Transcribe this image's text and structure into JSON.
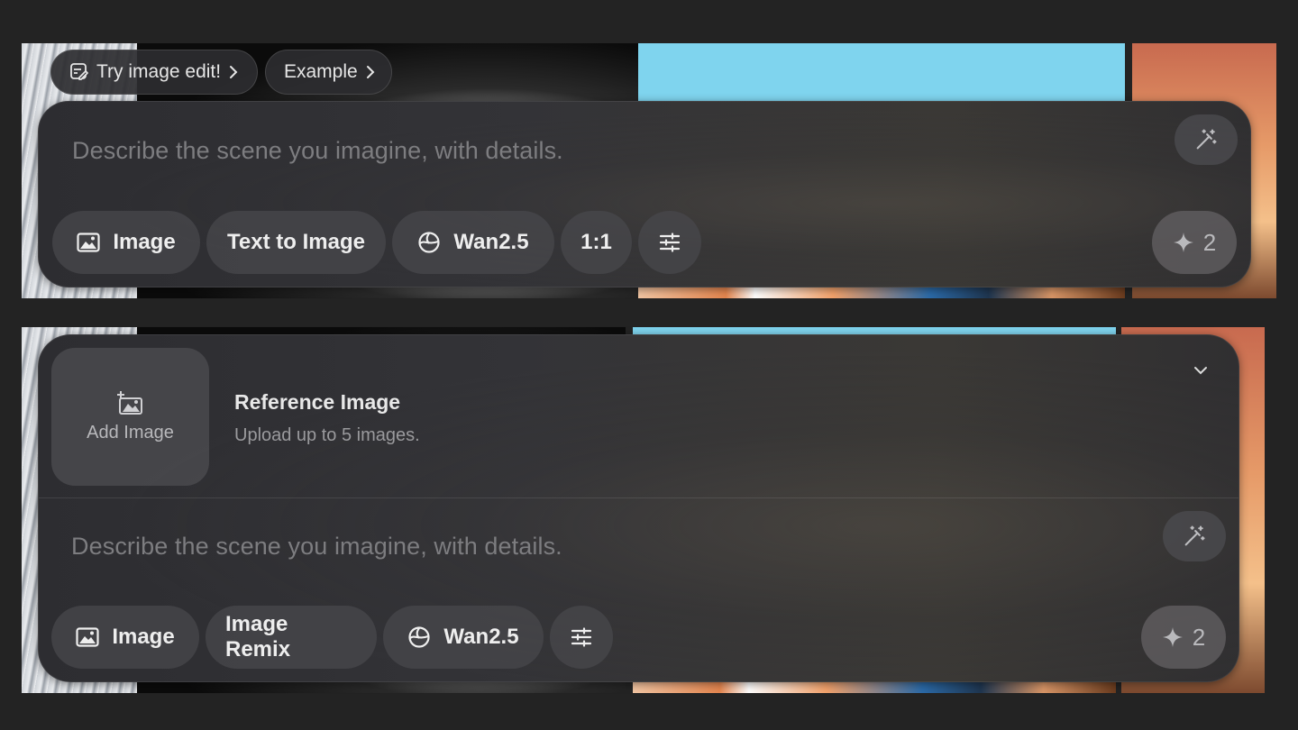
{
  "top_chips": {
    "try_edit": "Try image edit!",
    "example": "Example"
  },
  "panel1": {
    "placeholder": "Describe the scene you imagine, with details.",
    "mode": "Image",
    "task": "Text to Image",
    "model": "Wan2.5",
    "ratio": "1:1",
    "credits": "2"
  },
  "panel2": {
    "add_image": "Add Image",
    "ref_title": "Reference Image",
    "ref_subtitle": "Upload up to 5 images.",
    "placeholder": "Describe the scene you imagine, with details.",
    "mode": "Image",
    "task": "Image Remix",
    "model": "Wan2.5",
    "credits": "2"
  },
  "icons": {
    "image": "image-icon",
    "model": "globe-model-icon",
    "settings": "sliders-icon",
    "wand": "magic-wand-icon",
    "sparkle": "sparkle-icon",
    "edit": "edit-image-icon",
    "chevron": "chevron-right-icon",
    "collapse": "chevron-down-icon",
    "add_image": "add-image-icon"
  }
}
